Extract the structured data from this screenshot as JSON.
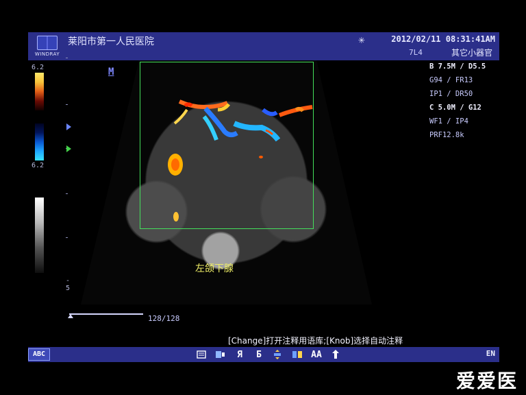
{
  "header": {
    "logo_name": "WINDRAY",
    "hospital": "莱阳市第一人民医院",
    "datetime": "2012/02/11  08:31:41AM",
    "probe": "7L4",
    "preset": "其它小器官"
  },
  "left_scale": {
    "top": "6.2",
    "bottom": "6.2",
    "depth_label": "- 5",
    "mode_marker": "M"
  },
  "right_params": [
    "B 7.5M / D5.5",
    "G94 / FR13",
    "IP1 / DR50",
    "C 5.0M / G12",
    "WF1 / IP4",
    "PRF12.8k"
  ],
  "image_annotation": "左颌下腺",
  "frame": {
    "count": "128/128"
  },
  "hint": "[Change]打开注释用语库;[Knob]选择自动注释",
  "bottom": {
    "abc_button": "ABC",
    "tools": [
      "Я",
      "Ƃ",
      "AA"
    ],
    "language": "EN"
  },
  "watermark": "爱爱医"
}
